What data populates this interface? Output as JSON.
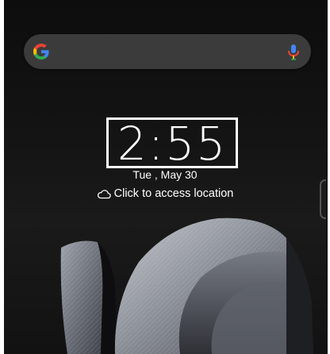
{
  "search": {
    "logo_icon": "google-g-icon",
    "mic_icon": "microphone-icon"
  },
  "clock": {
    "time": "2:55",
    "date": "Tue , May 30"
  },
  "location": {
    "icon": "cloud-icon",
    "text": "Click to access location"
  },
  "colors": {
    "background": "#111111",
    "search_bar": "#3b3b3b",
    "text": "#ffffff"
  }
}
